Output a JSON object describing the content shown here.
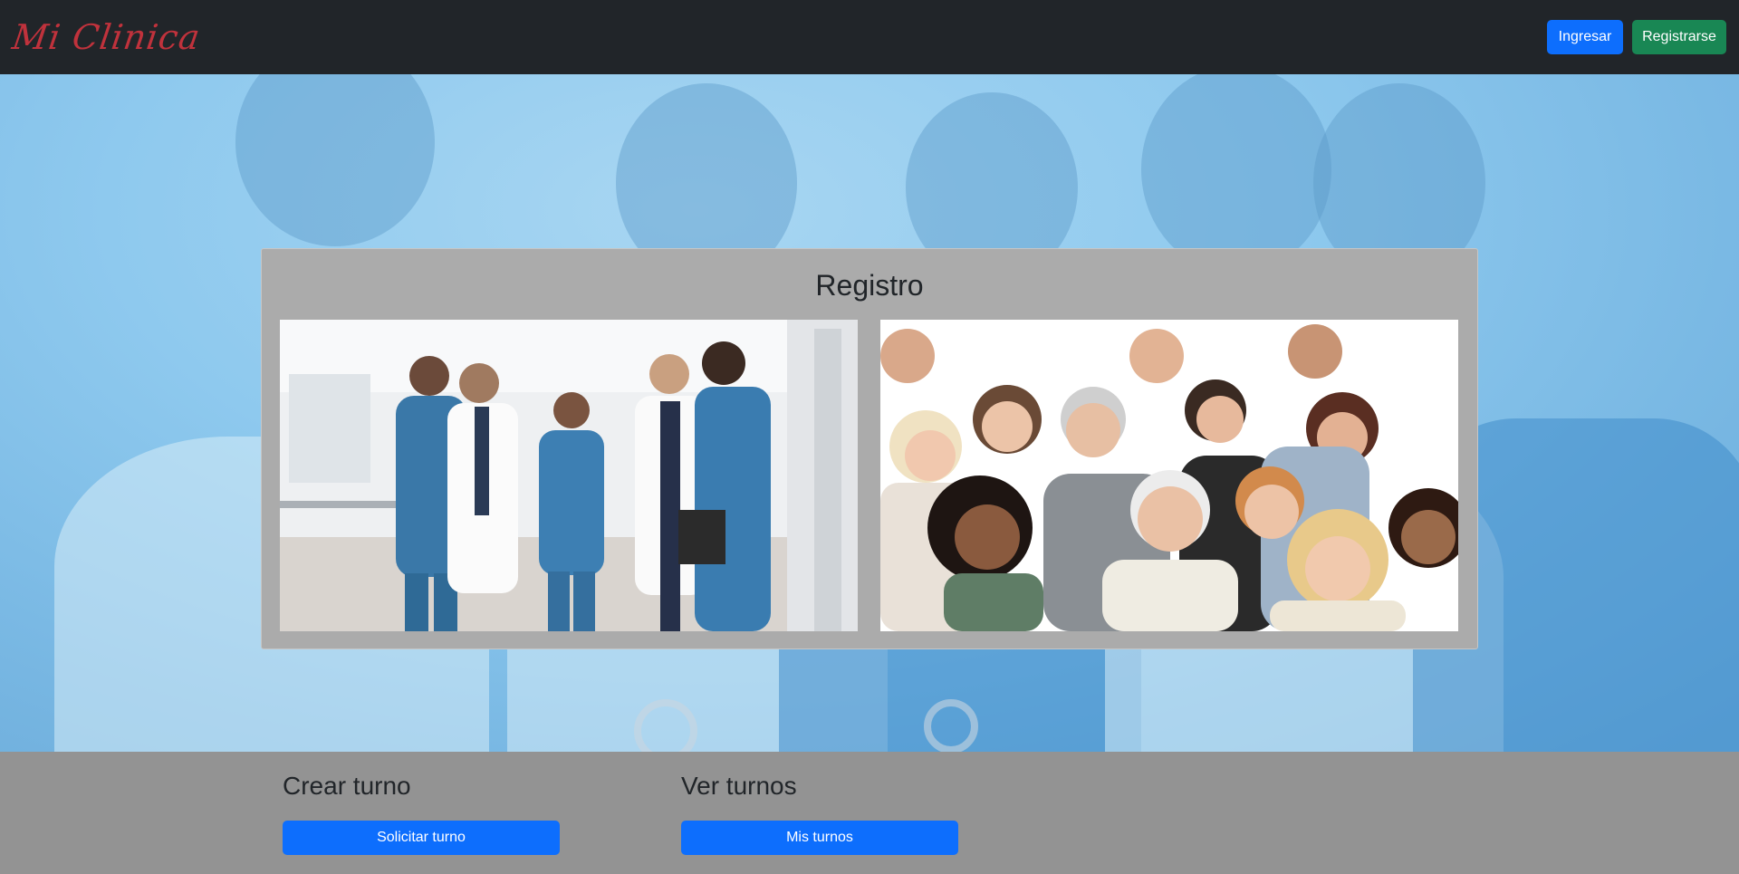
{
  "navbar": {
    "logo": "Mi Clinica",
    "login_label": "Ingresar",
    "register_label": "Registrarse"
  },
  "register_panel": {
    "title": "Registro",
    "options": [
      {
        "name": "staff-photo",
        "description_icon": "doctors-group-photo"
      },
      {
        "name": "patients-photo",
        "description_icon": "patients-group-photo"
      }
    ]
  },
  "actions": {
    "create": {
      "heading": "Crear turno",
      "button": "Solicitar turno"
    },
    "view": {
      "heading": "Ver turnos",
      "button": "Mis turnos"
    }
  },
  "colors": {
    "navbar": "#212529",
    "primary": "#0d6efd",
    "success": "#198754",
    "logo": "#c0323c",
    "panel": "#ababab",
    "footer": "#939393"
  }
}
